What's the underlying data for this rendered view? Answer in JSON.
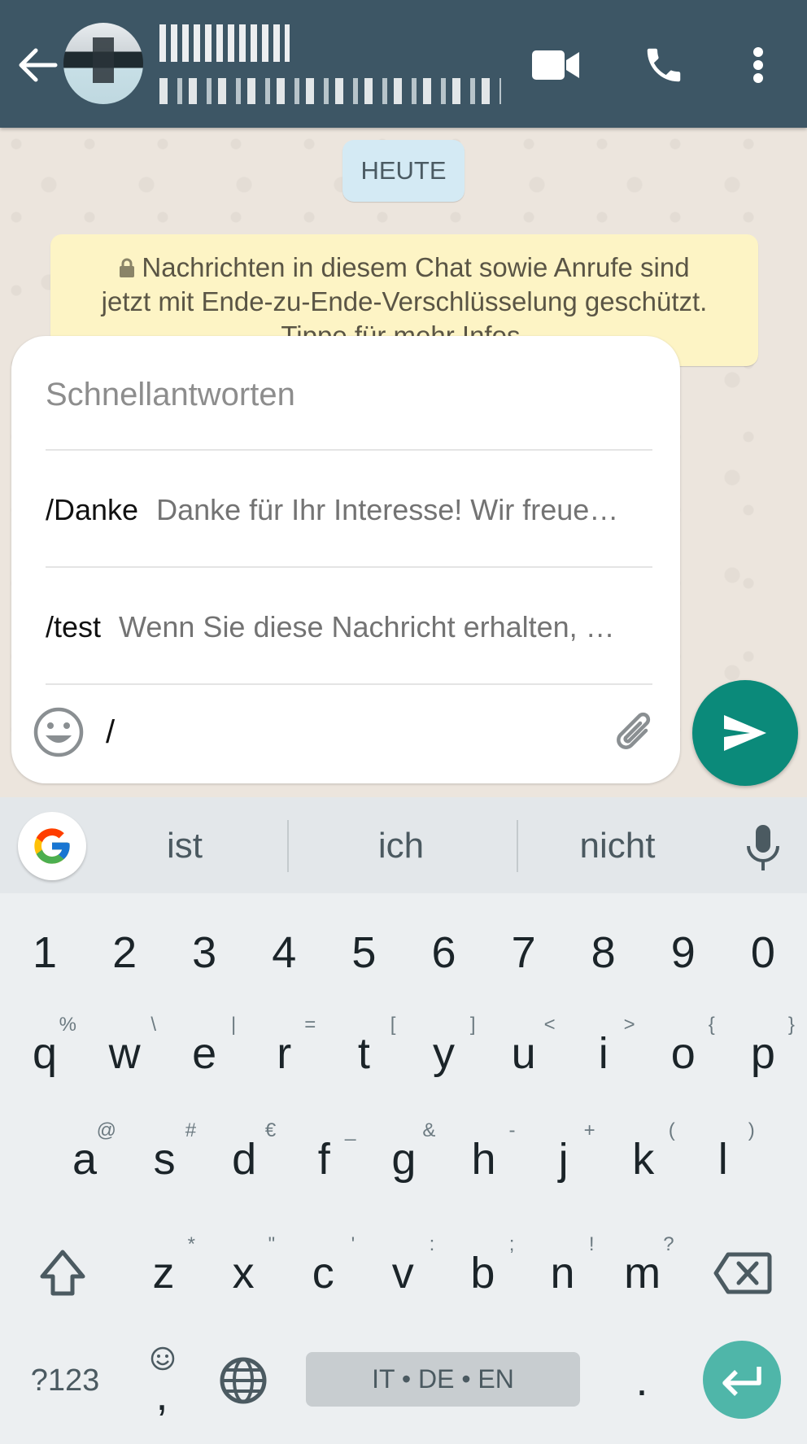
{
  "header": {
    "contact_name": "(redacted)",
    "contact_status": "(redacted)",
    "icons": {
      "back": "arrow-left-icon",
      "video": "video-camera-icon",
      "call": "phone-icon",
      "more": "more-vert-icon"
    }
  },
  "chat": {
    "date_badge": "HEUTE",
    "encryption_notice": {
      "line1": "Nachrichten in diesem Chat sowie Anrufe sind",
      "line2": "jetzt mit Ende-zu-Ende-Verschlüsselung geschützt.",
      "line3": "Tippe für mehr Infos."
    }
  },
  "quick_replies": {
    "title": "Schnellantworten",
    "items": [
      {
        "shortcut": "/Danke",
        "text": "Danke für Ihr Interesse! Wir freue…"
      },
      {
        "shortcut": "/test",
        "text": "Wenn Sie diese Nachricht erhalten, …"
      }
    ]
  },
  "composer": {
    "value": "/",
    "icons": {
      "emoji": "emoji-smile-icon",
      "attach": "paperclip-icon",
      "send": "send-icon"
    }
  },
  "keyboard": {
    "suggestions": [
      "ist",
      "ich",
      "nicht"
    ],
    "number_row": [
      "1",
      "2",
      "3",
      "4",
      "5",
      "6",
      "7",
      "8",
      "9",
      "0"
    ],
    "row1": [
      {
        "k": "q",
        "h": "%"
      },
      {
        "k": "w",
        "h": "\\"
      },
      {
        "k": "e",
        "h": "|"
      },
      {
        "k": "r",
        "h": "="
      },
      {
        "k": "t",
        "h": "["
      },
      {
        "k": "y",
        "h": "]"
      },
      {
        "k": "u",
        "h": "<"
      },
      {
        "k": "i",
        "h": ">"
      },
      {
        "k": "o",
        "h": "{"
      },
      {
        "k": "p",
        "h": "}"
      }
    ],
    "row2": [
      {
        "k": "a",
        "h": "@"
      },
      {
        "k": "s",
        "h": "#"
      },
      {
        "k": "d",
        "h": "€"
      },
      {
        "k": "f",
        "h": "_"
      },
      {
        "k": "g",
        "h": "&"
      },
      {
        "k": "h",
        "h": "-"
      },
      {
        "k": "j",
        "h": "+"
      },
      {
        "k": "k",
        "h": "("
      },
      {
        "k": "l",
        "h": ")"
      }
    ],
    "row3": [
      {
        "k": "z",
        "h": "*"
      },
      {
        "k": "x",
        "h": "\""
      },
      {
        "k": "c",
        "h": "'"
      },
      {
        "k": "v",
        "h": ":"
      },
      {
        "k": "b",
        "h": ";"
      },
      {
        "k": "n",
        "h": "!"
      },
      {
        "k": "m",
        "h": "?"
      }
    ],
    "symbols_label": "?123",
    "comma": ",",
    "space_label": "IT • DE • EN",
    "period": ".",
    "colors": {
      "accent": "#4fb6a9",
      "header": "#3d5665",
      "send": "#0b8a7a"
    }
  }
}
